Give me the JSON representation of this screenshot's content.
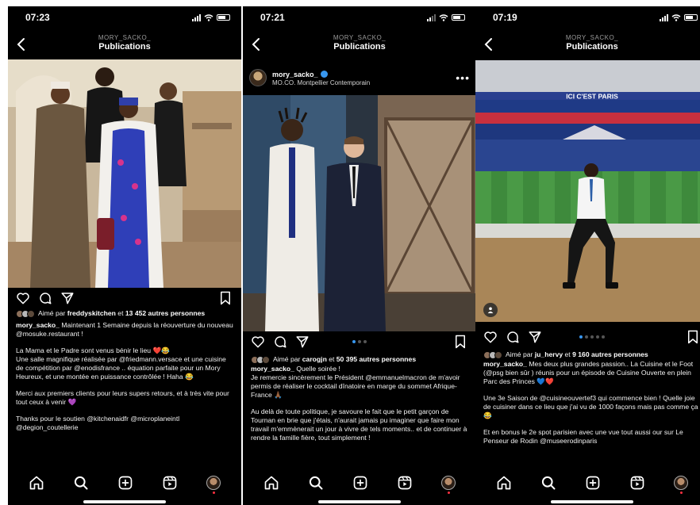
{
  "screens": [
    {
      "time": "07:23",
      "header": {
        "username": "MORY_SACKO_",
        "title": "Publications"
      },
      "likes": {
        "prefix": "Aimé par ",
        "user": "freddyskitchen",
        "middle": " et ",
        "count": "13 452 autres personnes"
      },
      "caption": {
        "username": "mory_sacko_",
        "first": " Maintenant 1 Semaine depuis la réouverture du nouveau @mosuke.restaurant !",
        "paragraphs": [
          "La Mama et le Padre sont venus bénir le lieu ❤️😂\nUne salle magnifique réalisée par @friedmann.versace et une cuisine de compétition par @enodisfrance .. équation parfaite pour un Mory Heureux, et une montée en puissance contrôlée ! Haha 😂",
          "Merci aux premiers clients pour leurs supers retours, et à très vite pour tout ceux à venir 💜",
          "Thanks pour le soutien @kitchenaidfr @microplaneintl @degion_coutellerie"
        ]
      }
    },
    {
      "time": "07:21",
      "header": {
        "username": "MORY_SACKO_",
        "title": "Publications"
      },
      "post": {
        "username": "mory_sacko_",
        "location": "MO.CO. Montpellier Contemporain",
        "more": "•••"
      },
      "likes": {
        "prefix": "Aimé par ",
        "user": "carogjn",
        "middle": " et ",
        "count": "50 395 autres personnes"
      },
      "caption": {
        "username": "mory_sacko_",
        "first": " Quelle soirée !",
        "paragraphs": [
          "Je remercie sincèrement le Président @emmanuelmacron de m'avoir permis de réaliser le cocktail dînatoire en marge du sommet Afrique-France 🙏🏾",
          "Au delà de toute politique, je savoure le fait que le petit garçon de Tournan en brie que j'étais, n'aurait jamais pu imaginer que faire mon travail m'emmènerait un jour à vivre de tels moments.. et de continuer à rendre la famille fière, tout simplement !"
        ]
      }
    },
    {
      "time": "07:19",
      "header": {
        "username": "MORY_SACKO_",
        "title": "Publications"
      },
      "stadium_banner": "ICI C'EST PARIS",
      "likes": {
        "prefix": "Aimé par ",
        "user": "ju_hervy",
        "middle": " et ",
        "count": "9 160 autres personnes"
      },
      "caption": {
        "username": "mory_sacko_",
        "first": " Mes deux plus grandes passion.. La Cuisine et le Foot (@psg bien sûr ) réunis pour un épisode de Cuisine Ouverte en plein Parc des Princes 💙❤️",
        "paragraphs": [
          "Une 3e Saison de @cuisineouvertef3 qui commence bien ! Quelle joie de cuisiner dans ce lieu que j'ai vu de 1000 façons mais pas comme ça 😂",
          "Et en bonus le 2e spot parisien avec une vue tout aussi our sur Le Penseur de Rodin @museerodinparis"
        ]
      }
    }
  ],
  "icons": {
    "status": [
      "signal-icon",
      "wifi-icon",
      "battery-icon"
    ],
    "actions": [
      "heart-icon",
      "comment-icon",
      "share-icon",
      "bookmark-icon"
    ],
    "tabbar": [
      "home-icon",
      "search-icon",
      "new-post-icon",
      "reels-icon",
      "profile-avatar"
    ]
  },
  "colors": {
    "background": "#000000",
    "text": "#ffffff",
    "muted": "#9a9a9a",
    "verified": "#3897f0",
    "carousel_active": "#3897f0"
  },
  "carousel": {
    "active_index": [
      0,
      0,
      0
    ]
  }
}
